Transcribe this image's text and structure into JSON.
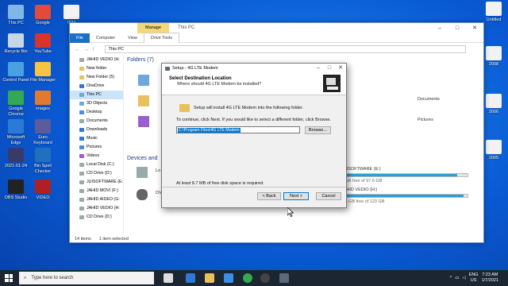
{
  "desktop": {
    "icons": [
      {
        "label": "This PC",
        "color": "#7fb8e8"
      },
      {
        "label": "Google",
        "color": "#e14b3b"
      },
      {
        "label": "IDM",
        "color": "#f2f2f2"
      },
      {
        "label": "Recycle Bin",
        "color": "#c8d7e6"
      },
      {
        "label": "YouTube",
        "color": "#d9342b"
      },
      {
        "label": "Control Panel",
        "color": "#4aa0e0"
      },
      {
        "label": "File Manager",
        "color": "#f5c542"
      },
      {
        "label": "Google Chrome",
        "color": "#34a853"
      },
      {
        "label": "images",
        "color": "#e07a30"
      },
      {
        "label": "Microsoft Edge",
        "color": "#2a7ad6"
      },
      {
        "label": "Euro Keyboard",
        "color": "#5c5c9c"
      },
      {
        "label": "2021-01-24",
        "color": "#3a3a6a"
      },
      {
        "label": "Bin Spell Checker",
        "color": "#2070c0"
      },
      {
        "label": "OBS Studio",
        "color": "#222222"
      },
      {
        "label": "VIDEO",
        "color": "#b02020"
      }
    ],
    "right_icons": [
      {
        "label": "Untitled",
        "color": "#f2f2f2"
      },
      {
        "label": "2008",
        "color": "#f2f2f2"
      },
      {
        "label": "2006",
        "color": "#f2f2f2"
      },
      {
        "label": "2005",
        "color": "#f2f2f2"
      }
    ]
  },
  "explorer": {
    "title": "This PC",
    "manage_tab": "Manage",
    "ribbon_tabs": [
      "File",
      "Computer",
      "View",
      "Drive Tools"
    ],
    "address": "This PC",
    "nav_items": [
      {
        "label": "JAHID VEDIO (H:",
        "color": "#9aa"
      },
      {
        "label": "New folder",
        "color": "#e8c060"
      },
      {
        "label": "New Folder (5)",
        "color": "#e8c060"
      },
      {
        "label": "OneDrive",
        "color": "#2a7ad6"
      },
      {
        "label": "This PC",
        "color": "#6fa8dc"
      },
      {
        "label": "3D Objects",
        "color": "#6fa8dc"
      },
      {
        "label": "Desktop",
        "color": "#4a90d9"
      },
      {
        "label": "Documents",
        "color": "#9aa"
      },
      {
        "label": "Downloads",
        "color": "#2a7ad6"
      },
      {
        "label": "Music",
        "color": "#2a7ad6"
      },
      {
        "label": "Pictures",
        "color": "#4a90d9"
      },
      {
        "label": "Videos",
        "color": "#9a5fd0"
      },
      {
        "label": "Local Disk (C:)",
        "color": "#9aa"
      },
      {
        "label": "CD Drive (D:)",
        "color": "#9aa"
      },
      {
        "label": "JUISOFTWARE (E:",
        "color": "#9aa"
      },
      {
        "label": "JAHID MOVI (F:)",
        "color": "#9aa"
      },
      {
        "label": "JAHID AIDEO (G:",
        "color": "#9aa"
      },
      {
        "label": "JAHID VEDIO (H:",
        "color": "#9aa"
      },
      {
        "label": "CD Drive (D:)",
        "color": "#9aa"
      }
    ],
    "folders_header": "Folders (7)",
    "devices_header": "Devices and",
    "content_labels": {
      "documents": "Documents",
      "pictures": "Pictures",
      "local": "Lo",
      "dvd": "DV"
    },
    "drives": [
      {
        "name": "JUISOFTWARE (E:)",
        "free": "0 GB free of 97.6 GB",
        "fill": 0.92
      },
      {
        "name": "JAHID VEDIO (H:)",
        "free": "0.5 GB free of 123 GB",
        "fill": 0.97
      }
    ],
    "status": {
      "items": "14 items",
      "selected": "1 item selected"
    }
  },
  "setup": {
    "title": "Setup - 4G LTE Modem",
    "heading": "Select Destination Location",
    "subheading": "Where should 4G LTE Modem be installed?",
    "line1": "Setup will install 4G LTE Modem into the following folder.",
    "line2": "To continue, click Next. If you would like to select a different folder, click Browse.",
    "path": "C:\\Program Files\\4G LTE Modem",
    "browse": "Browse...",
    "space": "At least 8.7 MB of free disk space is required.",
    "back": "< Back",
    "next": "Next >",
    "cancel": "Cancel"
  },
  "taskbar": {
    "search_placeholder": "Type here to search",
    "icons": [
      {
        "name": "task-view-icon",
        "color": "#dddddd"
      },
      {
        "name": "edge-icon",
        "color": "#2a7ad6"
      },
      {
        "name": "file-explorer-icon",
        "color": "#e8c060"
      },
      {
        "name": "store-icon",
        "color": "#3a8ee6"
      },
      {
        "name": "chrome-icon",
        "color": "#34a853"
      },
      {
        "name": "obs-icon",
        "color": "#444444"
      },
      {
        "name": "setup-icon",
        "color": "#5a6a7a"
      }
    ],
    "lang": "ENG",
    "region": "US",
    "time": "7:23 AM",
    "date": "1/7/2021"
  }
}
